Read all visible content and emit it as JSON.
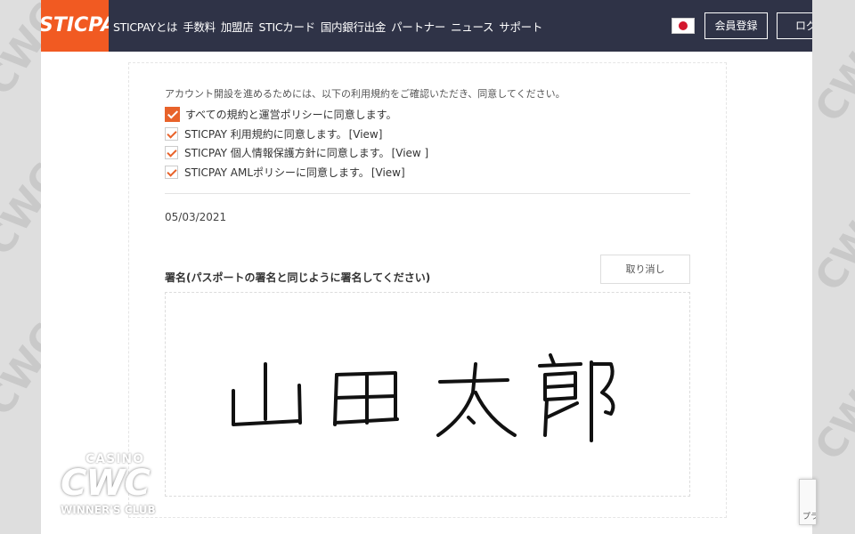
{
  "header": {
    "logo": "STICPAY",
    "nav": [
      "STICPAYとは",
      "手数料",
      "加盟店",
      "STICカード",
      "国内銀行出金",
      "パートナー",
      "ニュース",
      "サポート"
    ],
    "register_label": "会員登録",
    "login_label": "ログイン"
  },
  "agreement": {
    "intro": "アカウント開設を進めるためには、以下の利用規約をご確認いただき、同意してください。",
    "items": [
      {
        "label": "すべての規約と運営ポリシーに同意します。",
        "view": "",
        "checked": true
      },
      {
        "label": "STICPAY 利用規約に同意します。",
        "view": "[View]",
        "checked": true
      },
      {
        "label": "STICPAY 個人情報保護方針に同意します。",
        "view": "[View ]",
        "checked": true
      },
      {
        "label": "STICPAY AMLポリシーに同意します。",
        "view": "[View]",
        "checked": true
      }
    ]
  },
  "date": "05/03/2021",
  "signature": {
    "label": "署名(パスポートの署名と同じように署名してください)",
    "cancel_label": "取り消し",
    "drawn_text": "山田太郎"
  },
  "watermark": {
    "casino": "CASINO",
    "brand": "CWC",
    "sub": "WINNER'S CLUB"
  },
  "recaptcha": {
    "label": "プラ"
  },
  "colors": {
    "accent": "#f15a22",
    "header_bg": "#2f3347",
    "check": "#e8622a"
  }
}
